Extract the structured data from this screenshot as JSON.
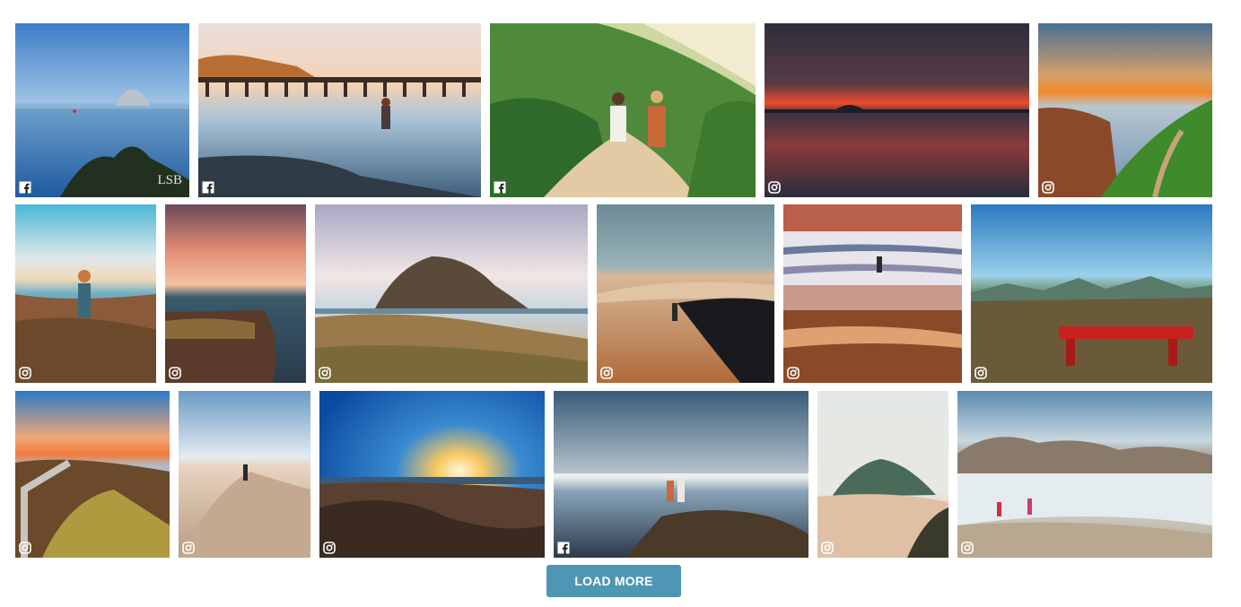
{
  "gallery": {
    "load_more_label": "LOAD MORE",
    "tiles": [
      {
        "source": "facebook",
        "scene": "morro-bay-kayak",
        "watermark": "LSB"
      },
      {
        "source": "facebook",
        "scene": "pier-beach-walker"
      },
      {
        "source": "facebook",
        "scene": "couple-hillside-trail"
      },
      {
        "source": "instagram",
        "scene": "red-sunset-ocean"
      },
      {
        "source": "instagram",
        "scene": "coastal-trail-sunset"
      },
      {
        "source": "instagram",
        "scene": "woman-coastal-bluff"
      },
      {
        "source": "instagram",
        "scene": "pink-sky-cliff"
      },
      {
        "source": "instagram",
        "scene": "morro-rock-dunes"
      },
      {
        "source": "instagram",
        "scene": "sand-dune-couple"
      },
      {
        "source": "instagram",
        "scene": "surfer-waves"
      },
      {
        "source": "instagram",
        "scene": "red-bench-mountains"
      },
      {
        "source": "instagram",
        "scene": "boardwalk-sunset"
      },
      {
        "source": "instagram",
        "scene": "dune-walker"
      },
      {
        "source": "instagram",
        "scene": "sunburst-rocky-shore"
      },
      {
        "source": "facebook",
        "scene": "couple-tidepools"
      },
      {
        "source": "instagram",
        "scene": "morro-rock-misty"
      },
      {
        "source": "instagram",
        "scene": "kids-beach-waves"
      }
    ]
  },
  "colors": {
    "button": "#4f95b4",
    "button_text": "#ffffff",
    "badge": "#ffffff"
  }
}
